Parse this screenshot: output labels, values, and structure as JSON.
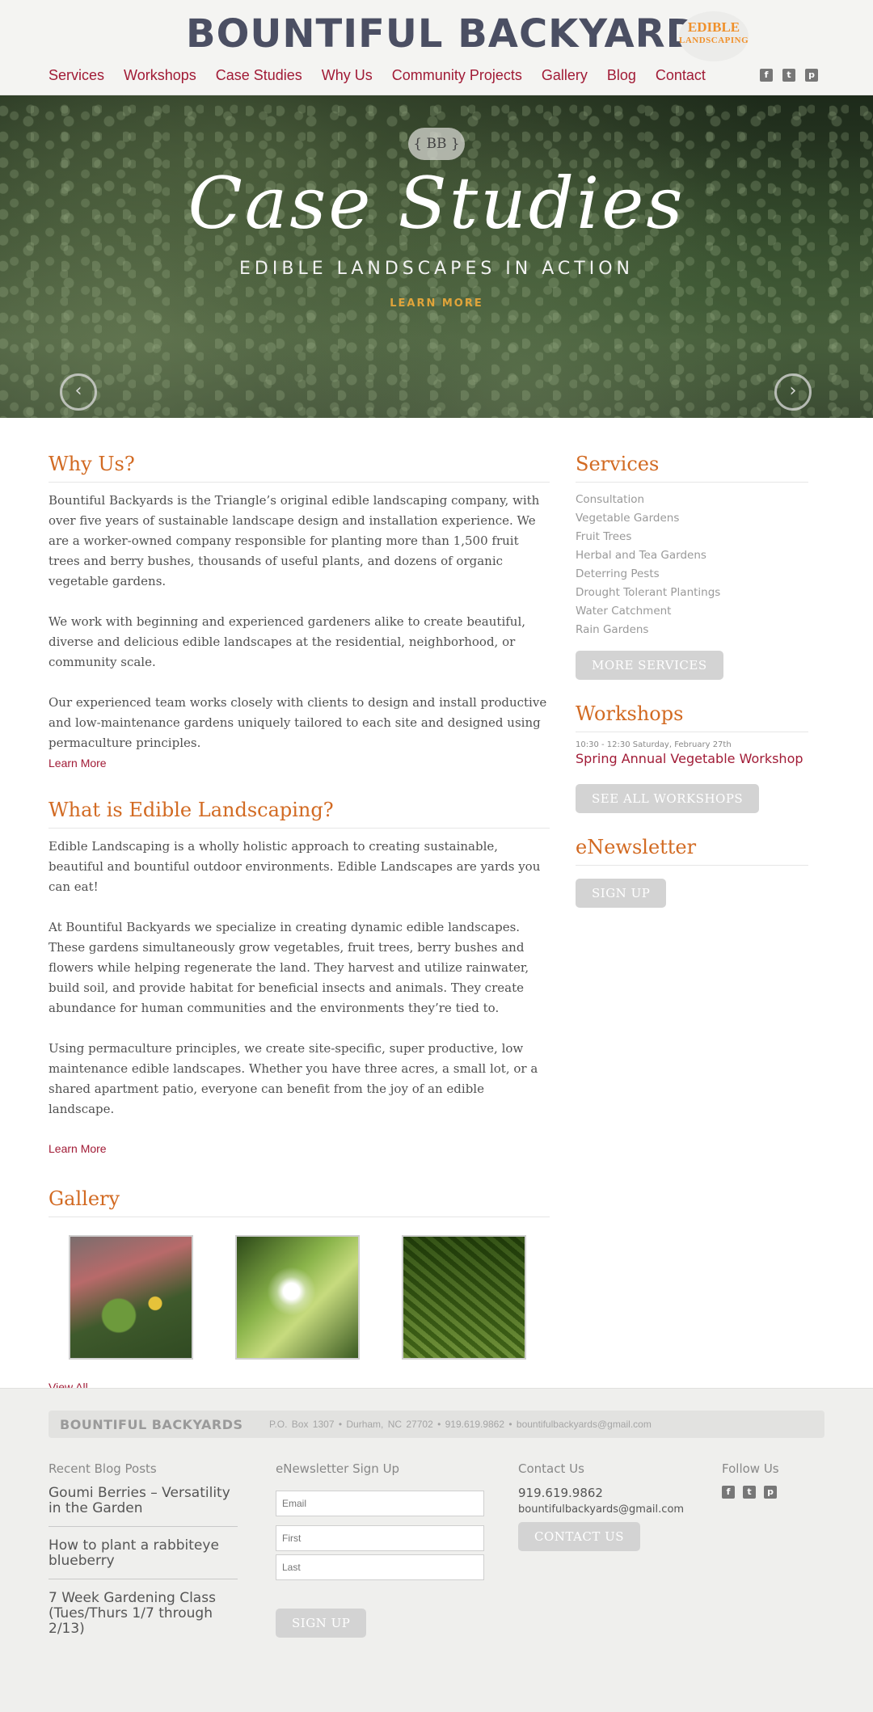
{
  "header": {
    "logo": "BOUNTIFUL BACKYARDS",
    "badge_line1": "EDIBLE",
    "badge_line2": "LANDSCAPING",
    "nav": [
      "Services",
      "Workshops",
      "Case Studies",
      "Why Us",
      "Community Projects",
      "Gallery",
      "Blog",
      "Contact"
    ],
    "social_icons": [
      "facebook-icon",
      "twitter-icon",
      "pinterest-icon"
    ]
  },
  "hero": {
    "badge": "{ BB }",
    "title": "Case Studies",
    "subtitle": "EDIBLE LANDSCAPES IN ACTION",
    "cta": "LEARN MORE",
    "prev_icon": "chevron-left-icon",
    "next_icon": "chevron-right-icon"
  },
  "why_us": {
    "heading": "Why Us?",
    "paragraphs": [
      "Bountiful Backyards is the Triangle’s original edible landscaping company, with over five years of sustainable landscape design and installation experience. We are a worker-owned company responsible for planting more than 1,500 fruit trees and berry bushes, thousands of useful plants, and dozens of organic vegetable gardens.",
      "We work with beginning and experienced gardeners alike to create beautiful, diverse and delicious edible landscapes at the residential, neighborhood, or community scale.",
      "Our experienced team works closely with clients to design and install productive and low-maintenance gardens uniquely tailored to each site and designed using permaculture principles."
    ],
    "link": "Learn More"
  },
  "edible": {
    "heading": "What is Edible Landscaping?",
    "paragraphs": [
      "Edible Landscaping is a wholly holistic approach to creating sustainable, beautiful and bountiful outdoor environments. Edible Landscapes are yards you can eat!",
      "At Bountiful Backyards we specialize in creating dynamic edible landscapes. These gardens simultaneously grow vegetables, fruit trees, berry bushes and flowers while helping regenerate the land. They harvest and utilize rainwater, build soil, and provide habitat for beneficial insects and animals. They create abundance for human communities and the environments they’re tied to.",
      "Using permaculture principles, we create site-specific, super productive, low maintenance edible landscapes. Whether you have three acres, a small lot, or a shared apartment patio, everyone can benefit from the joy of an edible landscape."
    ],
    "link": "Learn More"
  },
  "gallery": {
    "heading": "Gallery",
    "link": "View All"
  },
  "sidebar": {
    "services_heading": "Services",
    "services": [
      "Consultation",
      "Vegetable Gardens",
      "Fruit Trees",
      "Herbal and Tea Gardens",
      "Deterring Pests",
      "Drought Tolerant Plantings",
      "Water Catchment",
      "Rain Gardens"
    ],
    "more_services": "MORE SERVICES",
    "workshops_heading": "Workshops",
    "workshop_date": "10:30 - 12:30 Saturday, February 27th",
    "workshop_title": "Spring Annual Vegetable Workshop",
    "all_workshops": "SEE ALL WORKSHOPS",
    "newsletter_heading": "eNewsletter",
    "signup": "SIGN UP"
  },
  "footer": {
    "logo": "BOUNTIFUL BACKYARDS",
    "info": "P.O. Box 1307  •  Durham, NC 27702  •  919.619.9862  •  bountifulbackyards@gmail.com",
    "blog_heading": "Recent Blog Posts",
    "posts": [
      "Goumi Berries – Versatility in the Garden",
      "How to plant a rabbiteye blueberry",
      "7 Week Gardening Class (Tues/Thurs 1/7 through 2/13)"
    ],
    "newsletter_heading": "eNewsletter Sign Up",
    "email_placeholder": "Email",
    "first_placeholder": "First",
    "last_placeholder": "Last",
    "signup": "SIGN UP",
    "contact_heading": "Contact Us",
    "phone": "919.619.9862",
    "email": "bountifulbackyards@gmail.com",
    "contact_button": "CONTACT US",
    "follow_heading": "Follow Us"
  }
}
